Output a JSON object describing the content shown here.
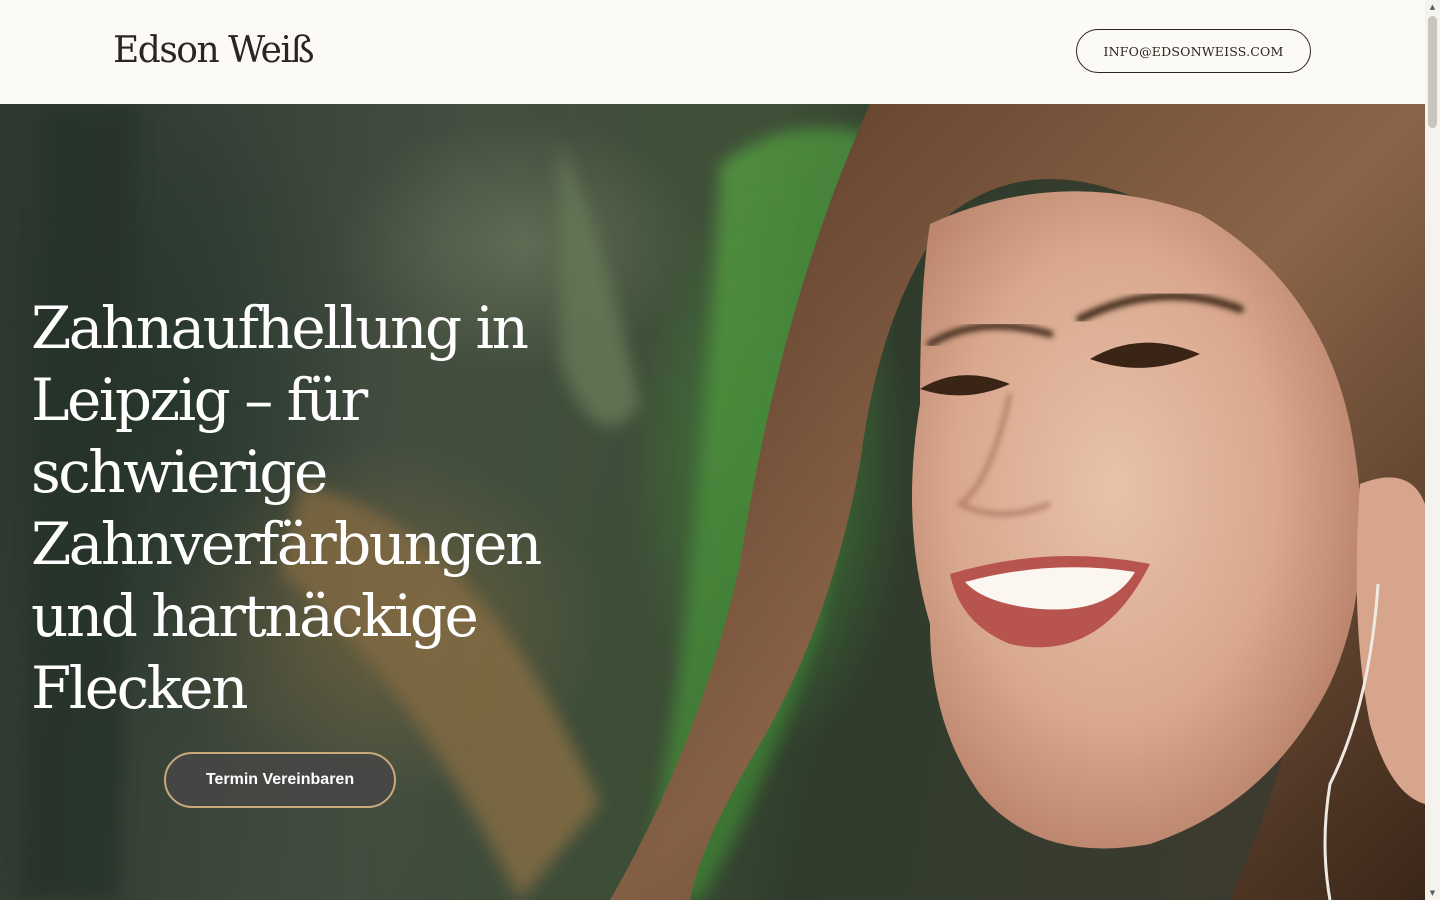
{
  "header": {
    "brand": "Edson Weiß",
    "email_button": "INFO@EDSONWEISS.COM"
  },
  "hero": {
    "headline": "Zahnaufhellung in Leipzig – für schwierige Zahnverfärbungen und hartnäckige Flecken",
    "cta_label": "Termin Vereinbaren",
    "image_alt": "smiling-woman-photo"
  },
  "colors": {
    "header_bg": "#fcfaf4",
    "text_dark": "#2a2521",
    "cta_bg": "#464644",
    "cta_border": "#c9a97c"
  },
  "scrollbar": {
    "up_icon": "triangle-up-icon",
    "down_icon": "triangle-down-icon"
  }
}
